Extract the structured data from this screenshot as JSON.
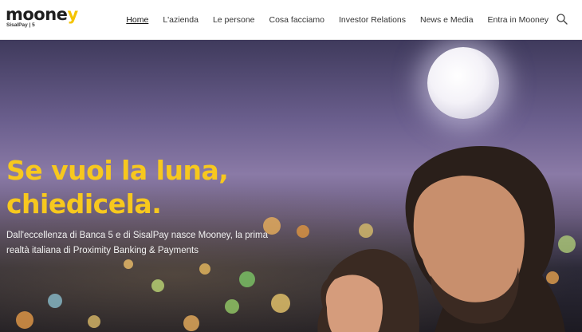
{
  "brand": {
    "logo_text_main": "moone",
    "logo_text_y": "y",
    "logo_subtext": "SisalPay | 5"
  },
  "nav": {
    "items": [
      {
        "label": "Home",
        "active": true
      },
      {
        "label": "L'azienda",
        "active": false
      },
      {
        "label": "Le persone",
        "active": false
      },
      {
        "label": "Cosa facciamo",
        "active": false
      },
      {
        "label": "Investor Relations",
        "active": false
      },
      {
        "label": "News e Media",
        "active": false
      },
      {
        "label": "Entra in Mooney",
        "active": false
      }
    ],
    "search_icon": "search-icon"
  },
  "hero": {
    "title_line1": "Se vuoi la luna,",
    "title_line2": "chiedicela.",
    "description_line1": "Dall'eccellenza di Banca 5 e di SisalPay nasce Mooney, la prima",
    "description_line2": "realtà italiana di Proximity Banking & Payments",
    "title_color": "#f7c81e"
  },
  "colors": {
    "accent": "#f5c400",
    "header_bg": "#ffffff",
    "nav_text": "#333333"
  }
}
